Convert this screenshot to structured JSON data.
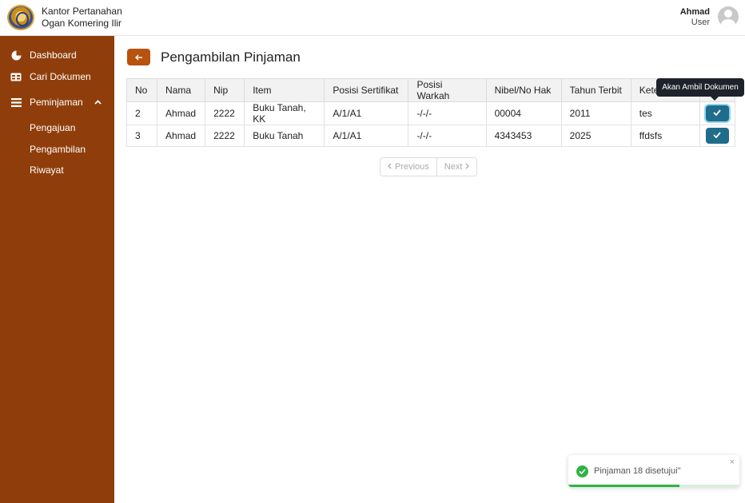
{
  "header": {
    "org_line1": "Kantor Pertanahan",
    "org_line2": "Ogan Komering Ilir",
    "user_name": "Ahmad",
    "user_role": "User"
  },
  "sidebar": {
    "items": [
      {
        "label": "Dashboard",
        "icon": "pie-chart-icon"
      },
      {
        "label": "Cari Dokumen",
        "icon": "table-icon"
      },
      {
        "label": "Peminjaman",
        "icon": "list-icon",
        "expanded": true
      }
    ],
    "sub_items": [
      "Pengajuan",
      "Pengambilan",
      "Riwayat"
    ]
  },
  "main": {
    "title": "Pengambilan Pinjaman",
    "table": {
      "columns": [
        "No",
        "Nama",
        "Nip",
        "Item",
        "Posisi Sertifikat",
        "Posisi Warkah",
        "Nibel/No Hak",
        "Tahun Terbit",
        "Kete"
      ],
      "rows": [
        [
          "2",
          "Ahmad",
          "2222",
          "Buku Tanah, KK",
          "A/1/A1",
          "-/-/-",
          "00004",
          "2011",
          "tes"
        ],
        [
          "3",
          "Ahmad",
          "2222",
          "Buku Tanah",
          "A/1/A1",
          "-/-/-",
          "4343453",
          "2025",
          "ffdsfs"
        ]
      ]
    },
    "tooltip": "Akan Ambil Dokumen",
    "pager": {
      "previous": "Previous",
      "next": "Next"
    }
  },
  "toast": {
    "message": "Pinjaman 18 disetujui\"",
    "close": "×",
    "progress": 0.65
  },
  "colors": {
    "sidebar": "#8f3e0b",
    "accent": "#b8520e",
    "action": "#1f6d8a",
    "success": "#2fb344"
  }
}
